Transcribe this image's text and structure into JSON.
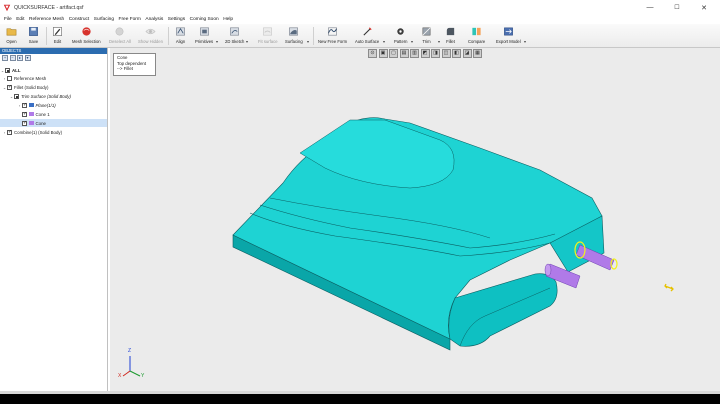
{
  "window": {
    "title": "QUICKSURFACE - artifact.qsf",
    "minimize": "—",
    "maximize": "☐",
    "close": "✕"
  },
  "menu": [
    "File",
    "Edit",
    "Reference Mesh",
    "Construct",
    "Surfacing",
    "Free Form",
    "Analysis",
    "Settings",
    "Coming Soon",
    "Help"
  ],
  "toolbar": {
    "open": "Open",
    "save": "Save",
    "edit": "Edit",
    "mesh_selection": "Mesh Selection",
    "deselect_all": "Deselect All",
    "show_hidden": "Show Hidden",
    "align": "Align",
    "primitives": "Primitives",
    "sketch_2d": "2D Sketch",
    "fit_surface": "Fit surface",
    "surfacing": "Surfacing",
    "new_free_form": "New Free Form",
    "auto_surface": "Auto Surface",
    "pattern": "Pattern",
    "trim": "Trim",
    "fillet": "Fillet",
    "compare": "Compare",
    "export_model": "Export Model"
  },
  "left_panel": {
    "header": "OBJECTS",
    "tree": {
      "all": "ALL",
      "reference_mesh": "Reference Mesh",
      "fillet": "Fillet (Solid Body)",
      "trim_surface": "Trim Surface (Solid Body)",
      "plane": "Plane(1/1)",
      "cone_1": "Cone 1",
      "cone": "Cone",
      "combine": "Combine(1) (Solid Body)"
    }
  },
  "tooltip": {
    "line1": "Cone",
    "line2": "Top dependent",
    "line3": "--> Fillet"
  },
  "axes": {
    "z": "Z",
    "x": "X",
    "y": "Y"
  },
  "colors": {
    "model": "#1ed3d3",
    "model_dark": "#0aa6a8",
    "cone": "#b07ae8",
    "selection": "#f2f21a",
    "accent": "#2b6cb0"
  }
}
